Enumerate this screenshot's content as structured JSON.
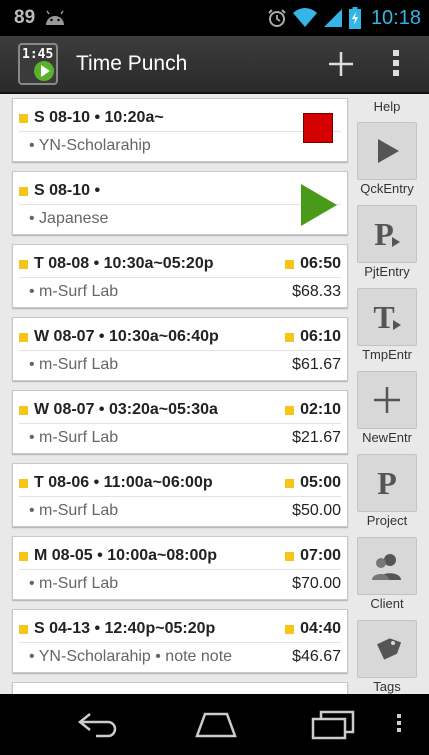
{
  "status_bar": {
    "battery_level": "89",
    "time": "10:18"
  },
  "action_bar": {
    "title": "Time Punch",
    "icon_text": "1:45"
  },
  "entries": [
    {
      "line1": "S 08-10 • 10:20a~",
      "line2": "• YN-Scholarahip",
      "duration": "",
      "amount": "",
      "action": "stop"
    },
    {
      "line1": "S 08-10 •",
      "line2": "• Japanese",
      "duration": "",
      "amount": "",
      "action": "play"
    },
    {
      "line1": "T 08-08 • 10:30a~05:20p",
      "line2": "• m-Surf Lab",
      "duration": "06:50",
      "amount": "$68.33"
    },
    {
      "line1": "W 08-07 • 10:30a~06:40p",
      "line2": "• m-Surf Lab",
      "duration": "06:10",
      "amount": "$61.67"
    },
    {
      "line1": "W 08-07 • 03:20a~05:30a",
      "line2": "• m-Surf Lab",
      "duration": "02:10",
      "amount": "$21.67"
    },
    {
      "line1": "T 08-06 • 11:00a~06:00p",
      "line2": "• m-Surf Lab",
      "duration": "05:00",
      "amount": "$50.00"
    },
    {
      "line1": "M 08-05 • 10:00a~08:00p",
      "line2": "• m-Surf Lab",
      "duration": "07:00",
      "amount": "$70.00"
    },
    {
      "line1": "S 04-13 • 12:40p~05:20p",
      "line2": "• YN-Scholarahip • note note",
      "duration": "04:40",
      "amount": "$46.67"
    }
  ],
  "sidebar": {
    "help": "Help",
    "qck_entry": "QckEntry",
    "pjt_entry": "PjtEntry",
    "tmp_entr": "TmpEntr",
    "new_entr": "NewEntr",
    "project": "Project",
    "client": "Client",
    "tags": "Tags"
  },
  "colors": {
    "accent_blue": "#33b5e5",
    "stop_red": "#d40000",
    "play_green": "#4a9a1a",
    "marker_yellow": "#f5c518"
  }
}
